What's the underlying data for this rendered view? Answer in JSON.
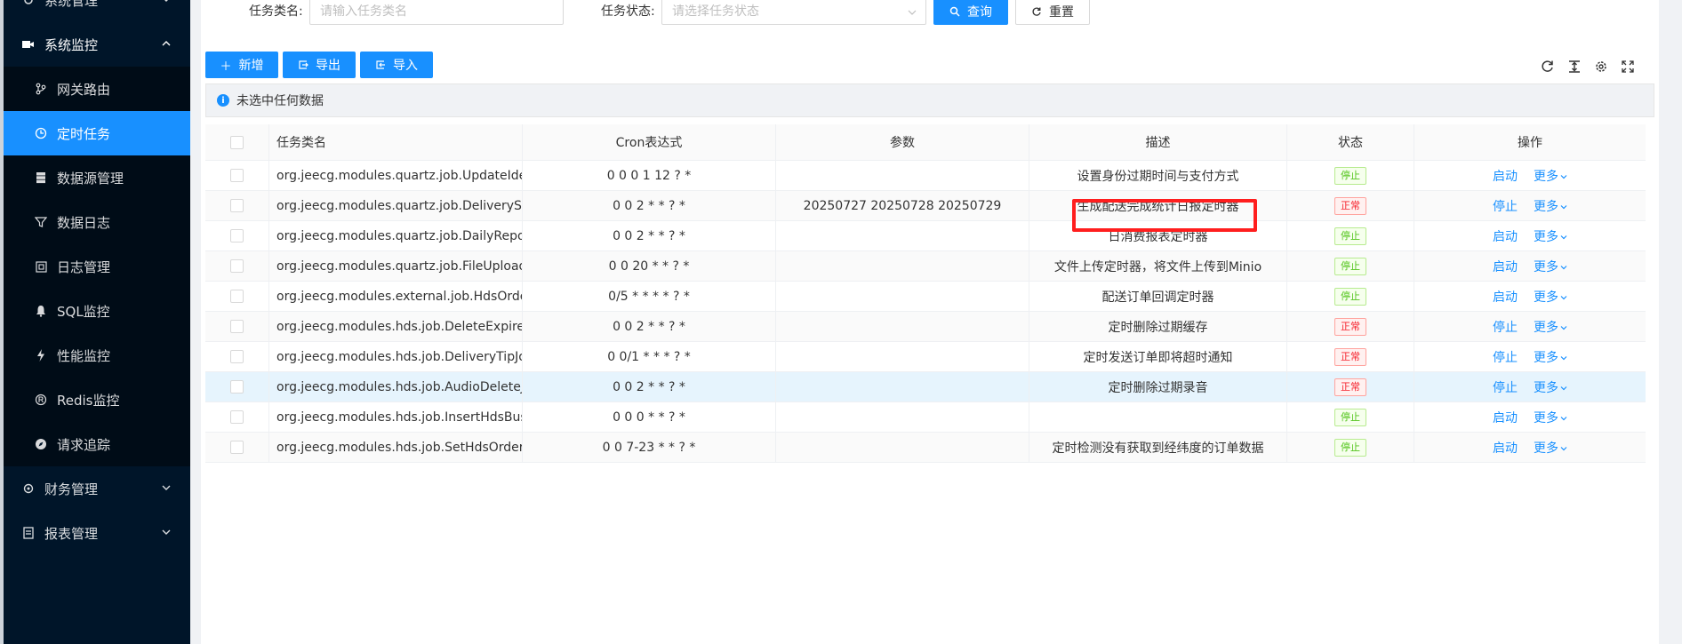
{
  "sidebar": {
    "top_partial": "系统管理",
    "monitor": {
      "label": "系统监控"
    },
    "items": [
      {
        "label": "网关路由",
        "icon": "branch-icon"
      },
      {
        "label": "定时任务",
        "icon": "clock-icon",
        "active": true
      },
      {
        "label": "数据源管理",
        "icon": "database-icon"
      },
      {
        "label": "数据日志",
        "icon": "filter-icon"
      },
      {
        "label": "日志管理",
        "icon": "log-icon"
      },
      {
        "label": "SQL监控",
        "icon": "bell-icon"
      },
      {
        "label": "性能监控",
        "icon": "thunder-icon"
      },
      {
        "label": "Redis监控",
        "icon": "registered-icon"
      },
      {
        "label": "请求追踪",
        "icon": "compass-icon"
      }
    ],
    "finance": {
      "label": "财务管理"
    },
    "report": {
      "label": "报表管理"
    }
  },
  "search": {
    "job_name_label": "任务类名:",
    "job_name_placeholder": "请输入任务类名",
    "status_label": "任务状态:",
    "status_placeholder": "请选择任务状态",
    "query_label": "查询",
    "reset_label": "重置"
  },
  "toolbar": {
    "add_label": "新增",
    "export_label": "导出",
    "import_label": "导入"
  },
  "alert": {
    "text": "未选中任何数据"
  },
  "table": {
    "headers": {
      "name": "任务类名",
      "cron": "Cron表达式",
      "params": "参数",
      "desc": "描述",
      "status": "状态",
      "ops": "操作"
    },
    "more_label": "更多",
    "rows": [
      {
        "name": "org.jeecg.modules.quartz.job.UpdateIdent...",
        "cron": "0 0 0 1 12 ? *",
        "params": "",
        "desc": "设置身份过期时间与支付方式",
        "status": "停止",
        "status_type": "stop",
        "action": "启动"
      },
      {
        "name": "org.jeecg.modules.quartz.job.DeliverySucc...",
        "cron": "0 0 2 * * ? *",
        "params": "20250727 20250728 20250729",
        "desc": "生成配送完成统计日报定时器",
        "status": "正常",
        "status_type": "normal",
        "action": "停止"
      },
      {
        "name": "org.jeecg.modules.quartz.job.DailyReportJ...",
        "cron": "0 0 2 * * ? *",
        "params": "",
        "desc": "日消费报表定时器",
        "status": "停止",
        "status_type": "stop",
        "action": "启动"
      },
      {
        "name": "org.jeecg.modules.quartz.job.FileUploadJob",
        "cron": "0 0 20 * * ? *",
        "params": "",
        "desc": "文件上传定时器，将文件上传到Minio",
        "status": "停止",
        "status_type": "stop",
        "action": "启动"
      },
      {
        "name": "org.jeecg.modules.external.job.HdsOrder...",
        "cron": "0/5 * * * * ? *",
        "params": "",
        "desc": "配送订单回调定时器",
        "status": "停止",
        "status_type": "stop",
        "action": "启动"
      },
      {
        "name": "org.jeecg.modules.hds.job.DeleteExpireCa...",
        "cron": "0 0 2 * * ? *",
        "params": "",
        "desc": "定时删除过期缓存",
        "status": "正常",
        "status_type": "normal",
        "action": "停止"
      },
      {
        "name": "org.jeecg.modules.hds.job.DeliveryTipJob",
        "cron": "0 0/1 * * * ? *",
        "params": "",
        "desc": "定时发送订单即将超时通知",
        "status": "正常",
        "status_type": "normal",
        "action": "停止"
      },
      {
        "name": "org.jeecg.modules.hds.job.AudioDeleteJob",
        "cron": "0 0 2 * * ? *",
        "params": "",
        "desc": "定时删除过期录音",
        "status": "正常",
        "status_type": "normal",
        "action": "停止"
      },
      {
        "name": "org.jeecg.modules.hds.job.InsertHdsBusin...",
        "cron": "0 0 0 * * ? *",
        "params": "",
        "desc": "",
        "status": "停止",
        "status_type": "stop",
        "action": "启动"
      },
      {
        "name": "org.jeecg.modules.hds.job.SetHdsOrderLo...",
        "cron": "0 0 7-23 * * ? *",
        "params": "",
        "desc": "定时检测没有获取到经纬度的订单数据",
        "status": "停止",
        "status_type": "stop",
        "action": "启动"
      }
    ]
  },
  "colors": {
    "primary": "#1890ff",
    "sidebar_bg": "#001529",
    "highlight_box": "#ff1e1e"
  }
}
